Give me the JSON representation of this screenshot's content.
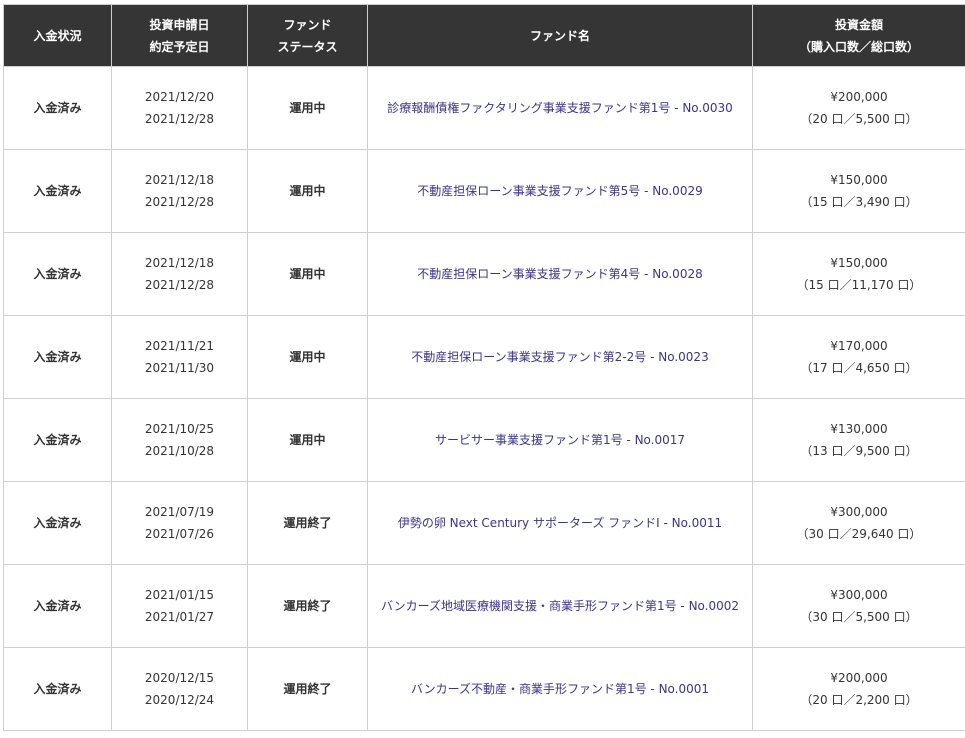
{
  "headers": {
    "payment_status": "入金状況",
    "dates": [
      "投資申請日",
      "約定予定日"
    ],
    "fund_status": [
      "ファンド",
      "ステータス"
    ],
    "fund_name": "ファンド名",
    "amount": [
      "投資金額",
      "（購入口数／総口数）"
    ]
  },
  "rows": [
    {
      "payment": "入金済み",
      "applied": "2021/12/20",
      "settle": "2021/12/28",
      "status": "運用中",
      "fund": "診療報酬債権ファクタリング事業支援ファンド第1号 - No.0030",
      "amount": "¥200,000",
      "units": "（20 口／5,500 口）"
    },
    {
      "payment": "入金済み",
      "applied": "2021/12/18",
      "settle": "2021/12/28",
      "status": "運用中",
      "fund": "不動産担保ローン事業支援ファンド第5号 - No.0029",
      "amount": "¥150,000",
      "units": "（15 口／3,490 口）"
    },
    {
      "payment": "入金済み",
      "applied": "2021/12/18",
      "settle": "2021/12/28",
      "status": "運用中",
      "fund": "不動産担保ローン事業支援ファンド第4号 - No.0028",
      "amount": "¥150,000",
      "units": "（15 口／11,170 口）"
    },
    {
      "payment": "入金済み",
      "applied": "2021/11/21",
      "settle": "2021/11/30",
      "status": "運用中",
      "fund": "不動産担保ローン事業支援ファンド第2-2号 - No.0023",
      "amount": "¥170,000",
      "units": "（17 口／4,650 口）"
    },
    {
      "payment": "入金済み",
      "applied": "2021/10/25",
      "settle": "2021/10/28",
      "status": "運用中",
      "fund": "サービサー事業支援ファンド第1号 - No.0017",
      "amount": "¥130,000",
      "units": "（13 口／9,500 口）"
    },
    {
      "payment": "入金済み",
      "applied": "2021/07/19",
      "settle": "2021/07/26",
      "status": "運用終了",
      "fund": "伊勢の卵 Next Century サポーターズ ファンドⅠ - No.0011",
      "amount": "¥300,000",
      "units": "（30 口／29,640 口）"
    },
    {
      "payment": "入金済み",
      "applied": "2021/01/15",
      "settle": "2021/01/27",
      "status": "運用終了",
      "fund": "バンカーズ地域医療機関支援・商業手形ファンド第1号 - No.0002",
      "amount": "¥300,000",
      "units": "（30 口／5,500 口）"
    },
    {
      "payment": "入金済み",
      "applied": "2020/12/15",
      "settle": "2020/12/24",
      "status": "運用終了",
      "fund": "バンカーズ不動産・商業手形ファンド第1号 - No.0001",
      "amount": "¥200,000",
      "units": "（20 口／2,200 口）"
    }
  ],
  "colors": {
    "header_bg": "#353535",
    "header_text": "#ffffff",
    "link": "#3b3488",
    "border": "#cfcfcf",
    "body_text": "#333333"
  }
}
